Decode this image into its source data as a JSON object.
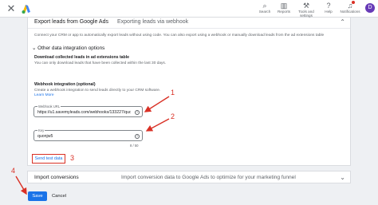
{
  "topbar": {
    "tools": [
      {
        "label": "Search",
        "icon": "search-icon",
        "glyph": "🔍"
      },
      {
        "label": "Reports",
        "icon": "reports-icon",
        "glyph": "▥"
      },
      {
        "label": "Tools and settings",
        "icon": "wrench-icon",
        "glyph": "🔧"
      },
      {
        "label": "Help",
        "icon": "help-icon",
        "glyph": "?"
      },
      {
        "label": "Notifications",
        "icon": "bell-icon",
        "glyph": "🔔"
      }
    ],
    "avatar": "D"
  },
  "card": {
    "title": "Export leads from Google Ads",
    "subtitle": "Exporting leads via webhook",
    "description": "Connect your CRM or app to automatically export leads without using code. You can also export using a webhook or manually download leads from the ad extensions table",
    "other_options": "Other data integration options",
    "download_title": "Download collected leads in ad extensions table",
    "download_desc": "You can only download leads that have been collected within the last 30 days.",
    "webhook_title": "Webhook integration (optional)",
    "webhook_desc": "Create a webhook integration to send leads directly to your CRM software.",
    "webhook_desc_link": "Learn More",
    "url_label": "Webhook URL",
    "url_value": "https://u1.savemyleads.com/webhooks/133227/quo",
    "key_label": "Key",
    "key_value": "quonjw5",
    "key_count": "8 / 50",
    "send_test": "Send test data"
  },
  "conversion": {
    "title": "Import conversions",
    "desc": "Import conversion data to Google Ads to optimize for your marketing funnel"
  },
  "footer": {
    "save": "Save",
    "cancel": "Cancel"
  },
  "annotations": [
    "1",
    "2",
    "3",
    "4"
  ],
  "colors": {
    "accent": "#1a73e8",
    "annotation": "#d93025"
  }
}
